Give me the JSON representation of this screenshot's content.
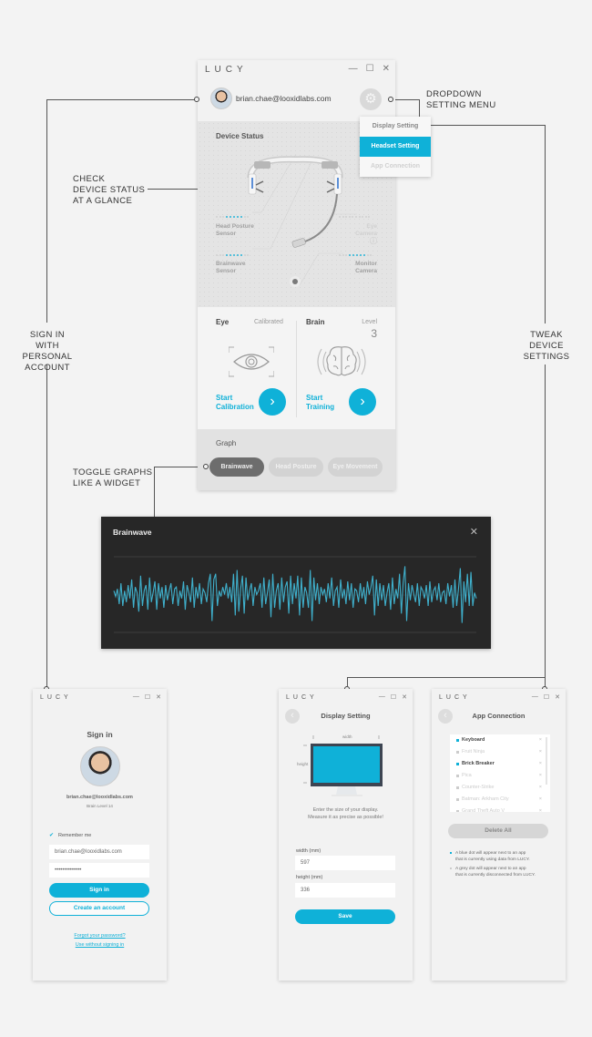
{
  "annotations": {
    "dropdown": [
      "DROPDOWN",
      "SETTING MENU"
    ],
    "device_status": [
      "CHECK",
      "DEVICE STATUS",
      "AT A GLANCE"
    ],
    "sign_in": [
      "SIGN IN WITH",
      "PERSONAL",
      "ACCOUNT"
    ],
    "tweak": [
      "TWEAK",
      "DEVICE",
      "SETTINGS"
    ],
    "toggle": [
      "TOGGLE GRAPHS",
      "LIKE A WIDGET"
    ]
  },
  "app_title": "LUCY",
  "window_controls": {
    "minimize": "—",
    "maximize": "☐",
    "close": "✕"
  },
  "main": {
    "user_email": "brian.chae@looxidlabs.com",
    "gear_icon": "⚙",
    "dropdown": [
      {
        "label": "Display Setting",
        "state": "normal"
      },
      {
        "label": "Headset Setting",
        "state": "selected"
      },
      {
        "label": "App Connection",
        "state": "disabled"
      }
    ],
    "device_status": {
      "title": "Device Status",
      "sensors": [
        {
          "name": "Head Posture Sensor",
          "line1": "Head Posture",
          "line2": "Sensor",
          "active": true,
          "signal_bars": 5,
          "max_bars": 10
        },
        {
          "name": "Eye Camera",
          "line1": "Eye",
          "line2": "Camera",
          "active": false,
          "signal_bars": 0,
          "max_bars": 10,
          "info_icon": "ⓘ"
        },
        {
          "name": "Brainwave Sensor",
          "line1": "Brainwave",
          "line2": "Sensor",
          "active": true,
          "signal_bars": 5,
          "max_bars": 10
        },
        {
          "name": "Monitor Camera",
          "line1": "Monitor",
          "line2": "Camera",
          "active": true,
          "signal_bars": 5,
          "max_bars": 10
        }
      ]
    },
    "eye_card": {
      "label": "Eye",
      "status": "Calibrated",
      "action_line1": "Start",
      "action_line2": "Calibration",
      "arrow": "›"
    },
    "brain_card": {
      "label": "Brain",
      "level_label": "Level",
      "level_value": "3",
      "action_line1": "Start",
      "action_line2": "Training",
      "arrow": "›"
    },
    "graph": {
      "title": "Graph",
      "toggles": [
        {
          "label": "Brainwave",
          "active": true
        },
        {
          "label": "Head Posture",
          "active": false
        },
        {
          "label": "Eye Movement",
          "active": false
        }
      ]
    }
  },
  "widget": {
    "title": "Brainwave",
    "close_icon": "✕",
    "color": "#3fb0cc"
  },
  "chart_data": {
    "type": "line",
    "title": "Brainwave",
    "xlabel": "",
    "ylabel": "",
    "ylim": [
      -1,
      1
    ],
    "grid": true,
    "x": "sample index 0-199",
    "series": [
      {
        "name": "Brainwave",
        "values": [
          0.1,
          -0.05,
          0.15,
          -0.25,
          0.3,
          -0.3,
          0.1,
          -0.2,
          0.25,
          -0.1,
          0.4,
          -0.35,
          0.2,
          0.05,
          -0.45,
          0.5,
          -0.3,
          0.1,
          0.25,
          -0.4,
          0.45,
          -0.2,
          0.05,
          0.35,
          -0.4,
          0.3,
          -0.1,
          0.2,
          -0.35,
          0.25,
          -0.15,
          0.1,
          0.3,
          -0.25,
          0.15,
          0.2,
          -0.3,
          0.1,
          -0.1,
          0.35,
          -0.4,
          0.25,
          0.05,
          -0.2,
          0.45,
          -0.35,
          0.2,
          -0.1,
          0.3,
          -0.25,
          0.15,
          0.05,
          -0.2,
          0.3,
          0.55,
          -0.7,
          0.4,
          0.55,
          -0.3,
          0.1,
          -0.05,
          0.2,
          0.0,
          0.3,
          -0.1,
          0.2,
          -0.2,
          0.55,
          -0.55,
          0.65,
          -0.45,
          0.15,
          0.5,
          -0.5,
          0.45,
          -0.15,
          0.1,
          0.3,
          -0.3,
          0.2,
          0.0,
          0.1,
          0.3,
          -0.35,
          0.45,
          -0.25,
          0.05,
          0.4,
          -0.6,
          0.55,
          -0.35,
          0.1,
          0.3,
          -0.4,
          0.45,
          -0.2,
          0.2,
          0.35,
          -0.5,
          0.5,
          -0.25,
          0.3,
          -0.1,
          0.5,
          -0.55,
          0.45,
          -0.35,
          0.2,
          0.05,
          -0.35,
          0.65,
          -0.7,
          0.45,
          -0.15,
          0.3,
          -0.25,
          0.2,
          0.0,
          0.15,
          -0.2,
          0.3,
          -0.1,
          0.45,
          -0.3,
          0.1,
          0.2,
          -0.35,
          0.4,
          -0.1,
          0.15,
          -0.25,
          0.35,
          -0.15,
          0.3,
          -0.35,
          0.15,
          0.1,
          -0.2,
          0.3,
          -0.1,
          0.2,
          -0.25,
          0.35,
          0.0,
          0.2,
          0.5,
          -0.55,
          0.4,
          -0.3,
          0.3,
          -0.15,
          0.25,
          -0.3,
          0.05,
          0.3,
          -0.4,
          0.45,
          -0.25,
          0.15,
          -0.1,
          0.55,
          -0.5,
          0.3,
          0.75,
          -0.7,
          0.3,
          -0.15,
          0.25,
          0.0,
          -0.2,
          0.3,
          -0.3,
          0.2,
          0.1,
          -0.1,
          0.25,
          -0.3,
          0.35,
          -0.2,
          0.1,
          0.2,
          -0.15,
          0.3,
          -0.2,
          0.05,
          0.1,
          -0.25,
          0.3,
          -0.05,
          0.25,
          -0.35,
          0.4,
          -0.3,
          0.15,
          0.7,
          -0.75,
          0.35,
          -0.2,
          0.55,
          -0.3,
          0.6,
          -0.3,
          0.05,
          -0.1
        ]
      }
    ]
  },
  "signin": {
    "title": "Sign in",
    "email": "brian.chae@looxidlabs.com",
    "level": "Brain Level 14",
    "remember_label": "Remember me",
    "remember_checked": true,
    "email_field": "brian.chae@looxidlabs.com",
    "password_field": "••••••••••••••",
    "signin_button": "Sign in",
    "create_button": "Create an account",
    "forgot_link": "Forgot your password?",
    "skip_link": "Use without signing in"
  },
  "display_setting": {
    "title": "Display Setting",
    "width_tick": "width",
    "height_tick": "height",
    "instruction_line1": "Enter the size of your display.",
    "instruction_line2": "Measure it as precise as possible!",
    "width_label": "width (mm)",
    "width_value": "597",
    "height_label": "height (mm)",
    "height_value": "336",
    "save_button": "Save",
    "screen_color": "#0fb1d8"
  },
  "app_connection": {
    "title": "App Connection",
    "apps": [
      {
        "name": "Keyboard",
        "connected": true
      },
      {
        "name": "Fruit Ninja",
        "connected": false
      },
      {
        "name": "Brick Breaker",
        "connected": true
      },
      {
        "name": "Pica",
        "connected": false
      },
      {
        "name": "Counter-Strike",
        "connected": false
      },
      {
        "name": "Batman: Arkham City",
        "connected": false
      },
      {
        "name": "Grand Theft Auto V",
        "connected": false
      }
    ],
    "remove_icon": "×",
    "delete_all_button": "Delete All",
    "note_blue_1": "A blue dot will appear next to an app",
    "note_blue_2": "that is currently using data from LUCY.",
    "note_grey_1": "A grey dot will appear next to an app",
    "note_grey_2": "that is currently disconnected from LUCY."
  },
  "back_icon": "‹"
}
